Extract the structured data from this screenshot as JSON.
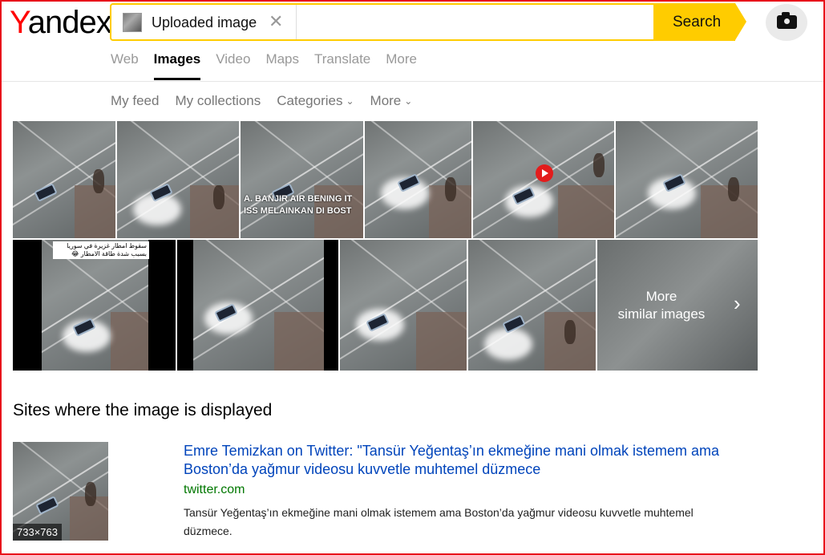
{
  "brand": {
    "logo_first": "Y",
    "logo_rest": "andex"
  },
  "search": {
    "chip_label": "Uploaded image",
    "chip_close": "✕",
    "button_label": "Search"
  },
  "tabs": [
    {
      "label": "Web",
      "active": false
    },
    {
      "label": "Images",
      "active": true
    },
    {
      "label": "Video",
      "active": false
    },
    {
      "label": "Maps",
      "active": false
    },
    {
      "label": "Translate",
      "active": false
    },
    {
      "label": "More",
      "active": false
    }
  ],
  "subnav": {
    "my_feed": "My feed",
    "my_collections": "My collections",
    "categories": "Categories",
    "more": "More",
    "chevron": "⌄"
  },
  "grid": {
    "row1_caption": "A. BANJIR AIR BENING IT\nISS MELAINKAN DI BOST",
    "row2_arabic": "سقوط امطار غزيرة في سوريا بسبب شدة طاقة الامطار 😂",
    "more_label": "More\nsimilar images",
    "more_chevron": "›"
  },
  "sites_section": {
    "title": "Sites where the image is displayed",
    "result": {
      "title": "Emre Temizkan on Twitter: \"Tansür Yeğentaş’ın ekmeğine mani olmak istemem ama Boston’da yağmur videosu kuvvetle muhtemel düzmece",
      "url": "twitter.com",
      "snippet": "Tansür Yeğentaş’ın ekmeğine mani olmak istemem ama Boston’da yağmur videosu kuvvetle muhtemel düzmece.",
      "dimensions": "733×763"
    }
  },
  "colors": {
    "accent": "#ffcc00",
    "link": "#0044bb",
    "url": "#007700",
    "frame": "#e8141b"
  },
  "icons": [
    "close-icon",
    "camera-icon",
    "chevron-down-icon",
    "play-icon",
    "chevron-right-icon"
  ]
}
